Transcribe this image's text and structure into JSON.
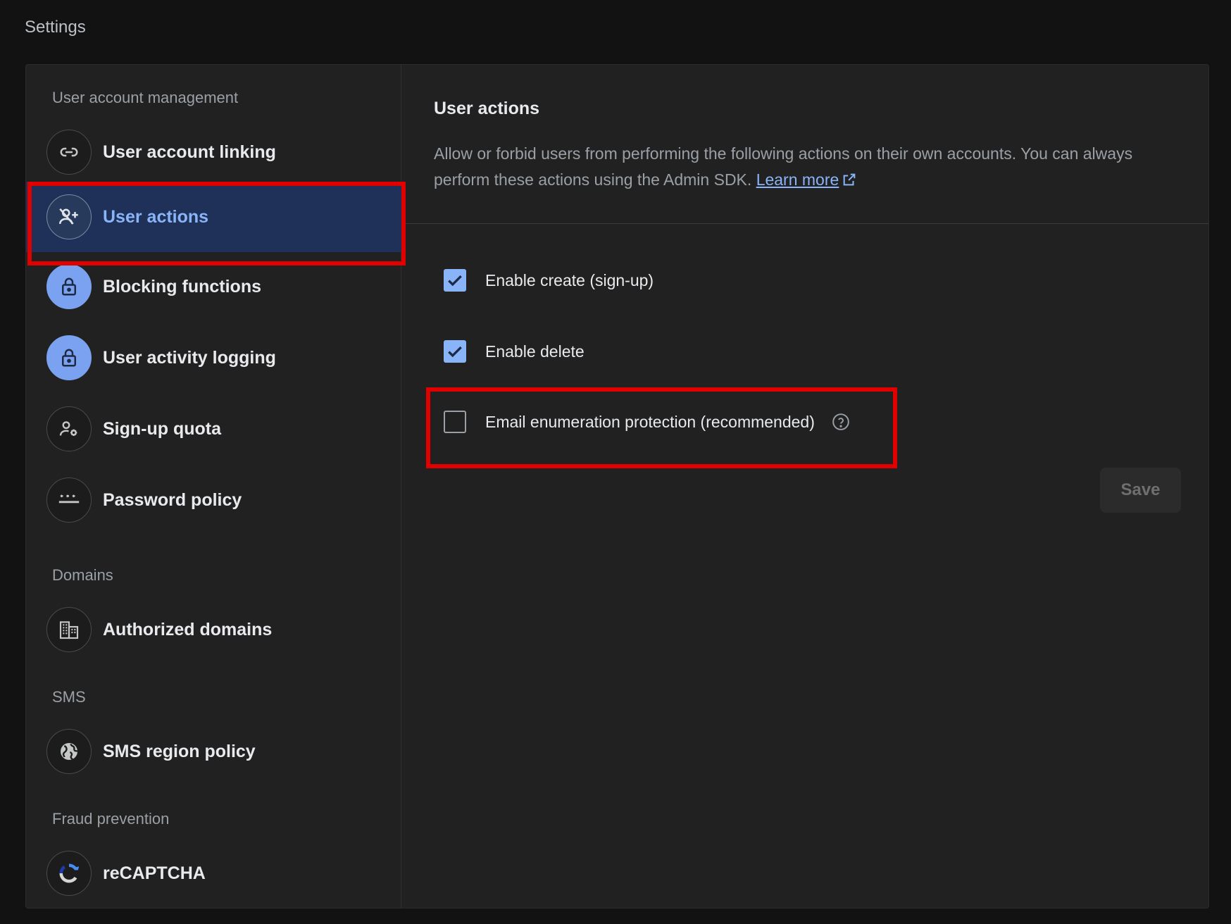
{
  "page": {
    "title": "Settings"
  },
  "sidebar": {
    "sections": [
      {
        "label": "User account management"
      },
      {
        "label": "Domains"
      },
      {
        "label": "SMS"
      },
      {
        "label": "Fraud prevention"
      }
    ],
    "items": [
      {
        "label": "User account linking",
        "icon": "link-icon"
      },
      {
        "label": "User actions",
        "icon": "person-add-icon",
        "active": true
      },
      {
        "label": "Blocking functions",
        "icon": "lock-icon"
      },
      {
        "label": "User activity logging",
        "icon": "lock-icon"
      },
      {
        "label": "Sign-up quota",
        "icon": "person-gear-icon"
      },
      {
        "label": "Password policy",
        "icon": "password-icon"
      },
      {
        "label": "Authorized domains",
        "icon": "building-icon"
      },
      {
        "label": "SMS region policy",
        "icon": "globe-icon"
      },
      {
        "label": "reCAPTCHA",
        "icon": "recaptcha-icon"
      }
    ]
  },
  "content": {
    "title": "User actions",
    "description": "Allow or forbid users from performing the following actions on their own accounts. You can always perform these actions using the Admin SDK.",
    "learn_more": "Learn more",
    "options": [
      {
        "label": "Enable create (sign-up)",
        "checked": true
      },
      {
        "label": "Enable delete",
        "checked": true
      },
      {
        "label": "Email enumeration protection (recommended)",
        "checked": false
      }
    ],
    "save_label": "Save"
  },
  "colors": {
    "accent": "#8ab4f8",
    "highlight": "#e00000",
    "active_bg": "#1f3158"
  }
}
